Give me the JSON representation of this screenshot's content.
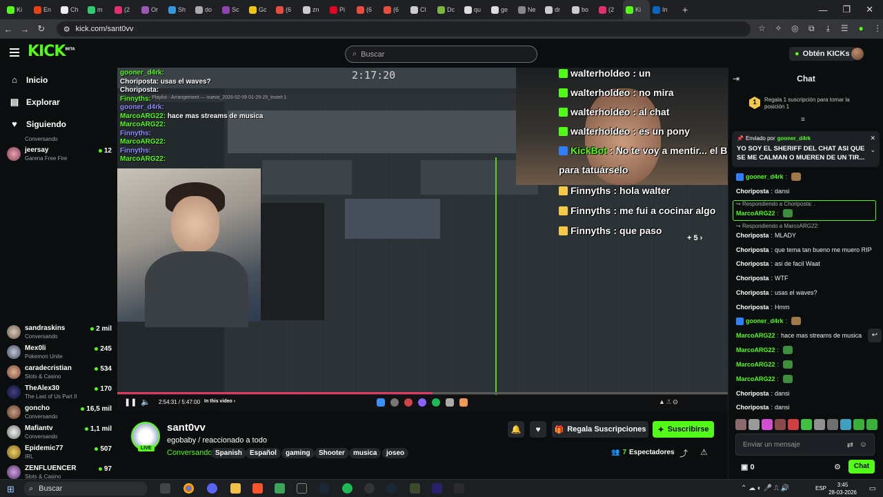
{
  "browser": {
    "tabs": [
      "Ki",
      "En",
      "Ch",
      "m",
      "(2",
      "Or",
      "Sh",
      "do",
      "Sc",
      "Gc",
      "(6",
      "zn",
      "Pi",
      "(6",
      "(6",
      "Cl",
      "Dc",
      "qu",
      "ge",
      "Ne",
      "dr",
      "bo",
      "(2",
      "Ki",
      "In"
    ],
    "url": "kick.com/sant0vv"
  },
  "header": {
    "logo": "KICK",
    "logo_beta": "BETA",
    "search_placeholder": "Buscar",
    "kicks_button": "Obtén KICKs"
  },
  "sidebar": {
    "nav": [
      {
        "label": "Inicio"
      },
      {
        "label": "Explorar"
      },
      {
        "label": "Siguiendo"
      }
    ],
    "top_category": "Conversando",
    "channels_top": [
      {
        "name": "jeersay",
        "category": "Garena Free Fire",
        "viewers": "12"
      }
    ],
    "channels": [
      {
        "name": "sandraskins",
        "category": "Conversando",
        "viewers": "2 mil"
      },
      {
        "name": "Mex0li",
        "category": "Pokemon Unite",
        "viewers": "245"
      },
      {
        "name": "caradecristian",
        "category": "Slots & Casino",
        "viewers": "534"
      },
      {
        "name": "TheAlex30",
        "category": "The Last of Us Part II",
        "viewers": "170"
      },
      {
        "name": "goncho",
        "category": "Conversando",
        "viewers": "16,5 mil"
      },
      {
        "name": "Mafiantv",
        "category": "Conversando",
        "viewers": "1,1 mil"
      },
      {
        "name": "Epidemic77",
        "category": "IRL",
        "viewers": "507"
      },
      {
        "name": "ZENFLUENCER",
        "category": "Slots & Casino",
        "viewers": "97"
      }
    ]
  },
  "video": {
    "daw_clock": "2:17:20",
    "daw_playlist_title": "Playlist - Arrangement — nuevo_2026-02-09 01-29-25_Insert 1",
    "overlay_small_chat": [
      {
        "user": "gooner_d4rk",
        "text": ""
      },
      {
        "user": "Choriposta",
        "text": "usas el waves?"
      },
      {
        "user": "Choriposta",
        "text": ""
      },
      {
        "user": "Finnyths",
        "text": ""
      },
      {
        "user": "gooner_d4rk",
        "text": ""
      },
      {
        "user": "MarcoARG22",
        "text": "hace mas streams de musica"
      },
      {
        "user": "MarcoARG22",
        "text": ""
      },
      {
        "user": "Finnyths",
        "text": ""
      },
      {
        "user": "MarcoARG22",
        "text": ""
      },
      {
        "user": "Finnyths",
        "text": ""
      },
      {
        "user": "MarcoARG22",
        "text": ""
      }
    ],
    "overlay_big_chat": [
      {
        "user": "walterholdeo",
        "text": "un",
        "color": "#ffffff"
      },
      {
        "user": "walterholdeo",
        "text": "no mira",
        "color": "#ffffff"
      },
      {
        "user": "walterholdeo",
        "text": "al chat",
        "color": "#ffffff"
      },
      {
        "user": "walterholdeo",
        "text": "es un pony",
        "color": "#ffffff"
      },
      {
        "user": "KickBot",
        "text": "No te voy a mentir... el Bitcoin está",
        "color": "#53fc18"
      },
      {
        "user": "",
        "text": "para tatuárselo",
        "color": "#ffffff"
      },
      {
        "user": "Finnyths",
        "text": "hola walter",
        "color": "#ffffff"
      },
      {
        "user": "Finnyths",
        "text": "me fui a cocinar algo",
        "color": "#ffffff"
      },
      {
        "user": "Finnyths",
        "text": "que paso",
        "color": "#ffffff"
      }
    ],
    "more_badge": "+ 5",
    "player_time": "2:54:31 / 5:47:00",
    "player_in_this_video": "In this video",
    "progress": 0.5
  },
  "stream": {
    "channel": "sant0vv",
    "live": "LIVE",
    "title": "egobaby / reaccionado a todo",
    "category": "Conversando",
    "tags": [
      "Spanish",
      "Español",
      "gaming",
      "Shooter",
      "musica",
      "joseo"
    ],
    "gift_button": "Regala Suscripciones",
    "subscribe_button": "Suscribirse",
    "viewers_count": "7",
    "viewers_label": "Espectadores"
  },
  "chat": {
    "title": "Chat",
    "promo_rank": "1",
    "promo_text": "Regala 1 suscripción para tomar la posición 1",
    "pinned_by_label": "Enviado por",
    "pinned_by_user": "gooner_d4rk",
    "pinned_text": "YO SOY EL SHERIFF DEL CHAT ASI QUE SE ME CALMAN O MUEREN DE UN TIR...",
    "messages": [
      {
        "user": "gooner_d4rk",
        "text": "",
        "color": "#53fc18",
        "badge": true
      },
      {
        "user": "Choriposta",
        "text": "dansi",
        "color": "#ffffff"
      },
      {
        "reply": "Respondiendo a Choriposta: ."
      },
      {
        "user": "MarcoARG22",
        "text": "",
        "color": "#53fc18"
      },
      {
        "reply": "Respondiendo a MarcoARG22:"
      },
      {
        "user": "Choriposta",
        "text": "MLADY",
        "color": "#ffffff"
      },
      {
        "user": "Choriposta",
        "text": "que tema tan bueno me muero RIP",
        "color": "#ffffff"
      },
      {
        "user": "Choriposta",
        "text": "asi de facil Waat",
        "color": "#ffffff"
      },
      {
        "user": "Choriposta",
        "text": "WTF",
        "color": "#ffffff"
      },
      {
        "user": "Choriposta",
        "text": "usas el waves?",
        "color": "#ffffff"
      },
      {
        "user": "Choriposta",
        "text": "Hmm",
        "color": "#ffffff"
      },
      {
        "user": "gooner_d4rk",
        "text": "",
        "color": "#53fc18",
        "badge": true
      },
      {
        "user": "MarcoARG22",
        "text": "hace mas streams de musica",
        "color": "#53fc18"
      },
      {
        "user": "MarcoARG22",
        "text": "",
        "color": "#53fc18"
      },
      {
        "user": "MarcoARG22",
        "text": "",
        "color": "#53fc18"
      },
      {
        "user": "MarcoARG22",
        "text": "",
        "color": "#53fc18"
      },
      {
        "user": "Choriposta",
        "text": "dansi",
        "color": "#ffffff"
      },
      {
        "user": "Choriposta",
        "text": "dansi",
        "color": "#ffffff"
      }
    ],
    "input_placeholder": "Enviar un mensaje",
    "points": "0",
    "send_button": "Chat"
  },
  "taskbar": {
    "search": "Buscar",
    "lang": "ESP",
    "time": "3:45",
    "date": "28-03-2026"
  },
  "colors": {
    "accent": "#53fc18",
    "background": "#0b0e0f",
    "progress": "#e23a5f"
  }
}
